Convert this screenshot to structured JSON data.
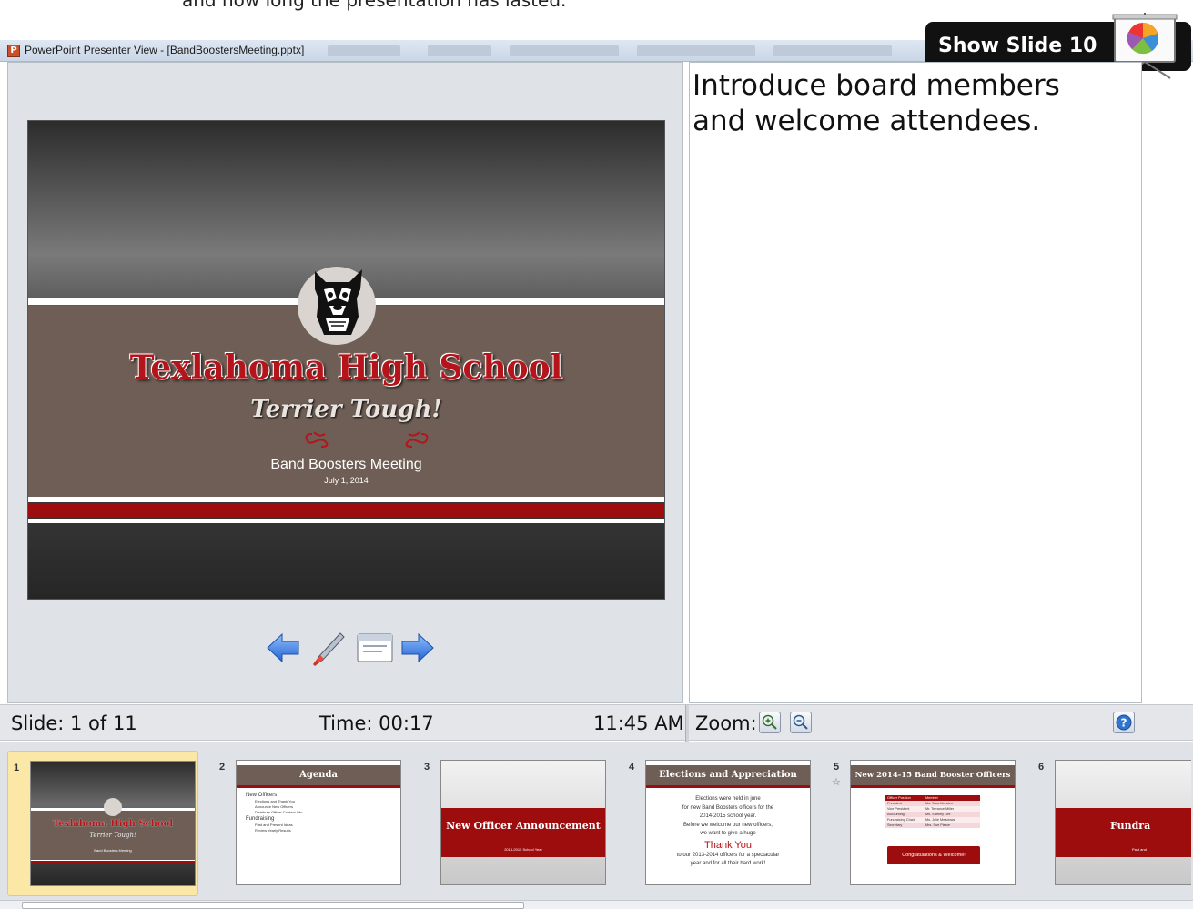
{
  "caption": {
    "text": "and how long the presentation has lasted."
  },
  "window": {
    "title": "PowerPoint Presenter View - [BandBoostersMeeting.pptx]",
    "app_icon": "P"
  },
  "callout": {
    "label": "Show Slide 10",
    "icon": "presentation-easel-icon"
  },
  "current_slide": {
    "school_name": "Texlahoma High School",
    "tagline": "Terrier Tough!",
    "ornament": "ℵ ℵ",
    "meeting_title": "Band Boosters Meeting",
    "date": "July 1, 2014"
  },
  "nav_controls": {
    "previous": "arrow-left-icon",
    "pen": "pen-icon",
    "menu": "slide-menu-icon",
    "next": "arrow-right-icon"
  },
  "notes": {
    "text": "Introduce board members and welcome attendees."
  },
  "status": {
    "slide_counter": "Slide: 1 of 11",
    "elapsed": "Time: 00:17",
    "clock": "11:45 AM",
    "zoom_label": "Zoom:"
  },
  "thumbnails": [
    {
      "number": "1",
      "title": "Texlahoma High School",
      "subtitle": "Terrier Tough!",
      "line": "Band Boosters Meeting",
      "selected": true
    },
    {
      "number": "2",
      "title": "Agenda",
      "bullets": [
        "New Officers",
        "Elections and Thank You",
        "Announce New Officers",
        "Distribute Officer Contact Info",
        "Fundraising",
        "Past and Present Ideas",
        "Review Yearly Results"
      ]
    },
    {
      "number": "3",
      "title": "New Officer Announcement",
      "subtitle": "2014-2015 School Year"
    },
    {
      "number": "4",
      "title": "Elections and Appreciation",
      "body": [
        "Elections were held in june",
        "for new Band Boosters officers for the",
        "2014-2015 school year.",
        "Before we welcome our new officers,",
        "we want to give a huge"
      ],
      "highlight": "Thank You",
      "body2": [
        "to our 2013-2014 officers for a spectacular",
        "year and for all their hard work!"
      ]
    },
    {
      "number": "5",
      "title": "New 2014-15 Band Booster Officers",
      "table_header": [
        "Officer Position",
        "Member"
      ],
      "table_rows": [
        [
          "President",
          "Ms. Sara Morales"
        ],
        [
          "Vice President",
          "Mr. Terrance Miller"
        ],
        [
          "Accounting",
          "Ms. Sammy Lee"
        ],
        [
          "Fundraising Chair",
          "Ms. Julie Meadows"
        ],
        [
          "Secretary",
          "Mrs. Sue Pierce"
        ]
      ],
      "banner": "Congratulations & Welcome!"
    },
    {
      "number": "6",
      "title": "Fundra",
      "subtitle": "Past and"
    }
  ]
}
